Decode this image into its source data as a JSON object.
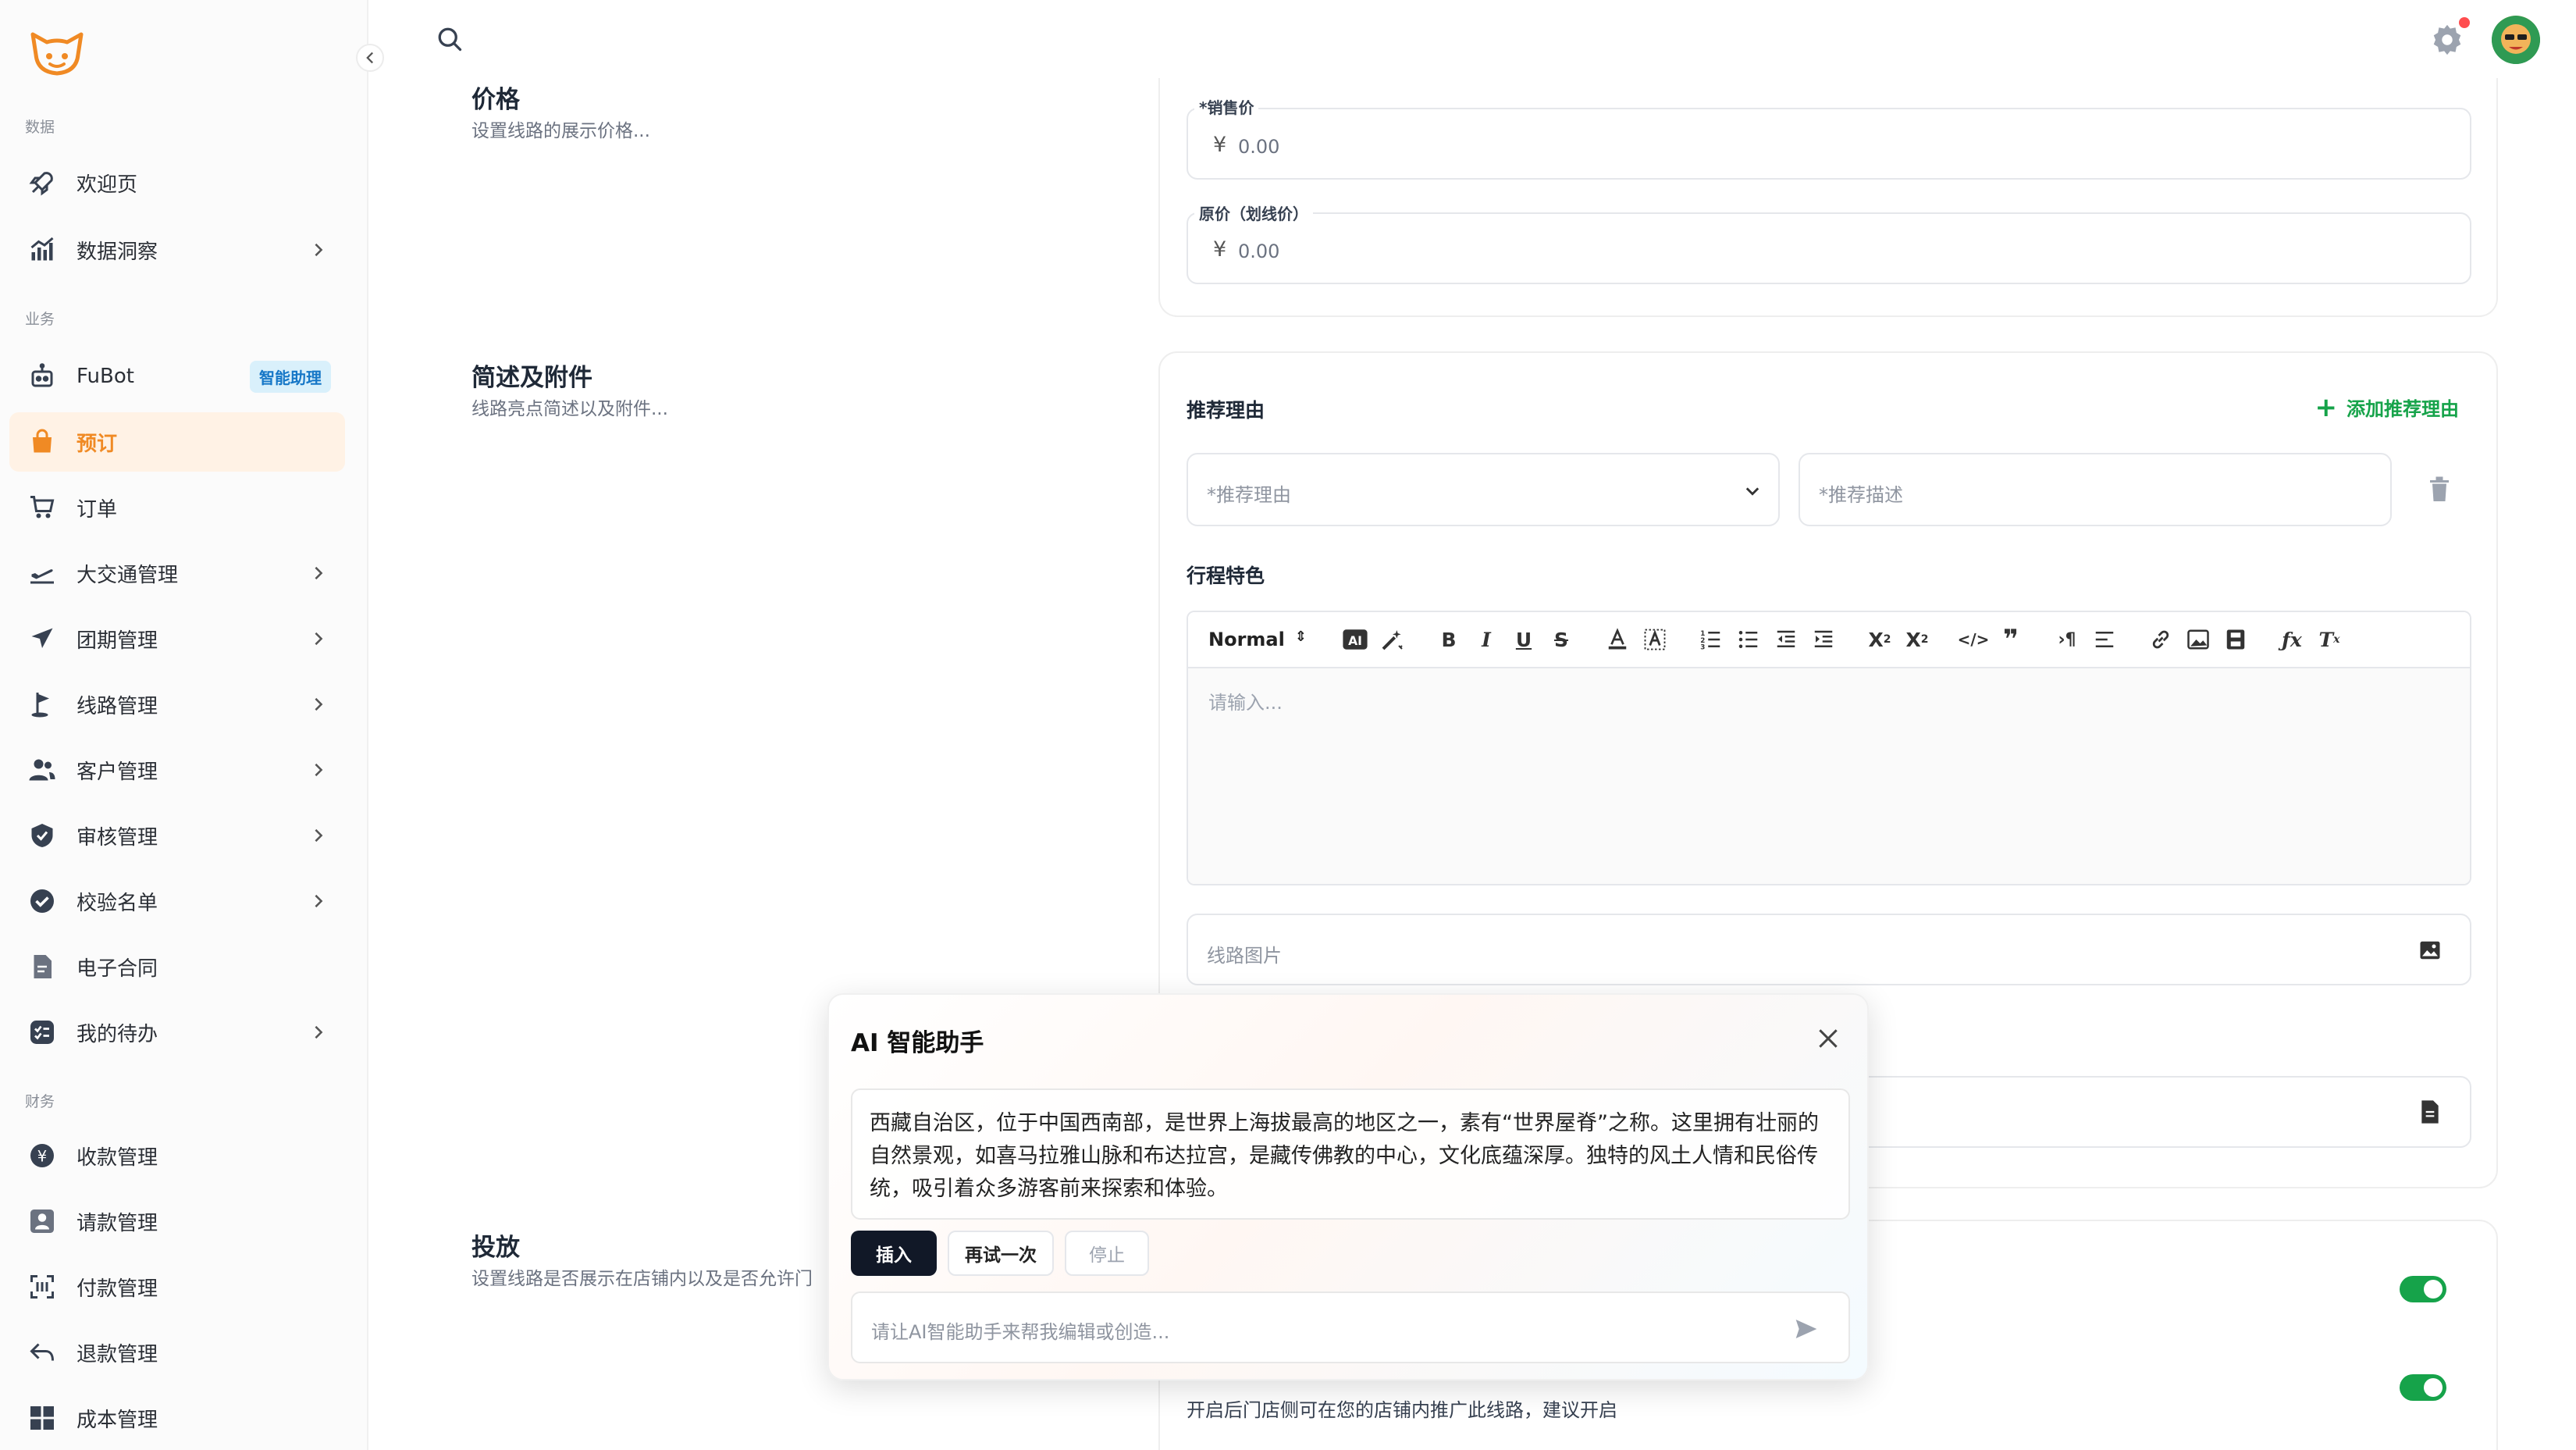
{
  "sidebar": {
    "sections": {
      "data": "数据",
      "business": "业务",
      "finance": "财务"
    },
    "items": [
      {
        "label": "欢迎页"
      },
      {
        "label": "数据洞察"
      },
      {
        "label": "FuBot",
        "badge": "智能助理"
      },
      {
        "label": "预订"
      },
      {
        "label": "订单"
      },
      {
        "label": "大交通管理"
      },
      {
        "label": "团期管理"
      },
      {
        "label": "线路管理"
      },
      {
        "label": "客户管理"
      },
      {
        "label": "审核管理"
      },
      {
        "label": "校验名单"
      },
      {
        "label": "电子合同"
      },
      {
        "label": "我的待办"
      },
      {
        "label": "收款管理"
      },
      {
        "label": "请款管理"
      },
      {
        "label": "付款管理"
      },
      {
        "label": "退款管理"
      },
      {
        "label": "成本管理"
      }
    ]
  },
  "sections": {
    "price": {
      "title": "价格",
      "desc": "设置线路的展示价格..."
    },
    "summary": {
      "title": "简述及附件",
      "desc": "线路亮点简述以及附件..."
    },
    "placement": {
      "title": "投放",
      "desc": "设置线路是否展示在店铺内以及是否允许门"
    }
  },
  "price_card": {
    "sale_label": "*销售价",
    "sale_value": "0.00",
    "original_label": "原价（划线价）",
    "original_value": "0.00",
    "currency": "¥"
  },
  "summary_card": {
    "reason_heading": "推荐理由",
    "add_reason": "添加推荐理由",
    "reason_placeholder": "*推荐理由",
    "desc_placeholder": "*推荐描述",
    "feature_heading": "行程特色",
    "editor_format": "Normal",
    "editor_placeholder": "请输入...",
    "image_placeholder": "线路图片"
  },
  "placement_card": {
    "promo_text": "开启后门店侧可在您的店铺内推广此线路，建议开启",
    "toggle1_on": true,
    "toggle2_on": true
  },
  "ai_dialog": {
    "title": "AI 智能助手",
    "content": "西藏自治区，位于中国西南部，是世界上海拔最高的地区之一，素有“世界屋脊”之称。这里拥有壮丽的自然景观，如喜马拉雅山脉和布达拉宫，是藏传佛教的中心，文化底蕴深厚。独特的风土人情和民俗传统，吸引着众多游客前来探索和体验。",
    "insert": "插入",
    "retry": "再试一次",
    "stop": "停止",
    "input_placeholder": "请让AI智能助手来帮我编辑或创造..."
  },
  "colors": {
    "accent": "#f08a24",
    "active_bg": "#fff2e5",
    "success": "#16a34a",
    "badge_bg": "#d9f0fb",
    "badge_text": "#1677c7"
  }
}
